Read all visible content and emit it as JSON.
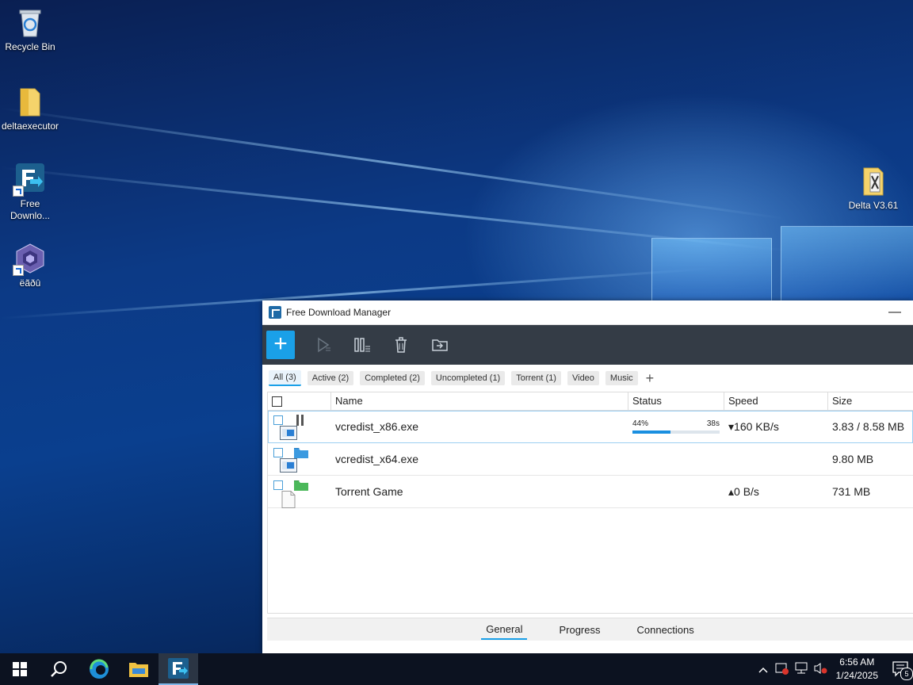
{
  "desktop": {
    "icons": [
      {
        "label": "Recycle Bin"
      },
      {
        "label": "deltaexecutor"
      },
      {
        "label": "Free Downlo..."
      },
      {
        "label": "ëãðû"
      },
      {
        "label": "Delta V3.61"
      }
    ]
  },
  "window": {
    "title": "Free Download Manager",
    "minimize_glyph": "—"
  },
  "toolbar": {
    "add_glyph": "+",
    "icons": [
      "plus-icon",
      "resume-icon",
      "pause-all-icon",
      "trash-icon",
      "move-to-folder-icon"
    ]
  },
  "filters": [
    {
      "label": "All (3)",
      "active": true
    },
    {
      "label": "Active (2)"
    },
    {
      "label": "Completed (2)"
    },
    {
      "label": "Uncompleted (1)"
    },
    {
      "label": "Torrent (1)"
    },
    {
      "label": "Video"
    },
    {
      "label": "Music"
    }
  ],
  "filter_add_glyph": "+",
  "table": {
    "columns": [
      "Name",
      "Status",
      "Speed",
      "Size"
    ],
    "rows": [
      {
        "name": "vcredist_x86.exe",
        "state": "pause-icon",
        "file": "exe-file-icon",
        "progress_label": "44%",
        "progress": 0.44,
        "eta": "38s",
        "speed": "▾160 KB/s",
        "size": "3.83 / 8.58 MB"
      },
      {
        "name": "vcredist_x64.exe",
        "state": "folder-icon",
        "file": "exe-file-icon",
        "progress_label": "",
        "eta": "",
        "speed": "",
        "size": "9.80 MB"
      },
      {
        "name": "Torrent Game",
        "state": "green-folder-icon",
        "file": "blank-file-icon",
        "progress_label": "",
        "eta": "",
        "speed": "▴0 B/s",
        "size": "731 MB"
      }
    ]
  },
  "bottom_tabs": [
    {
      "label": "General",
      "active": true
    },
    {
      "label": "Progress"
    },
    {
      "label": "Connections"
    }
  ],
  "taskbar": {
    "time": "6:56 AM",
    "date": "1/24/2025",
    "notification_count": "5"
  },
  "colors": {
    "accent": "#1aa0e8",
    "toolbar_bg": "#343c46",
    "taskbar_bg": "#0c1220"
  }
}
